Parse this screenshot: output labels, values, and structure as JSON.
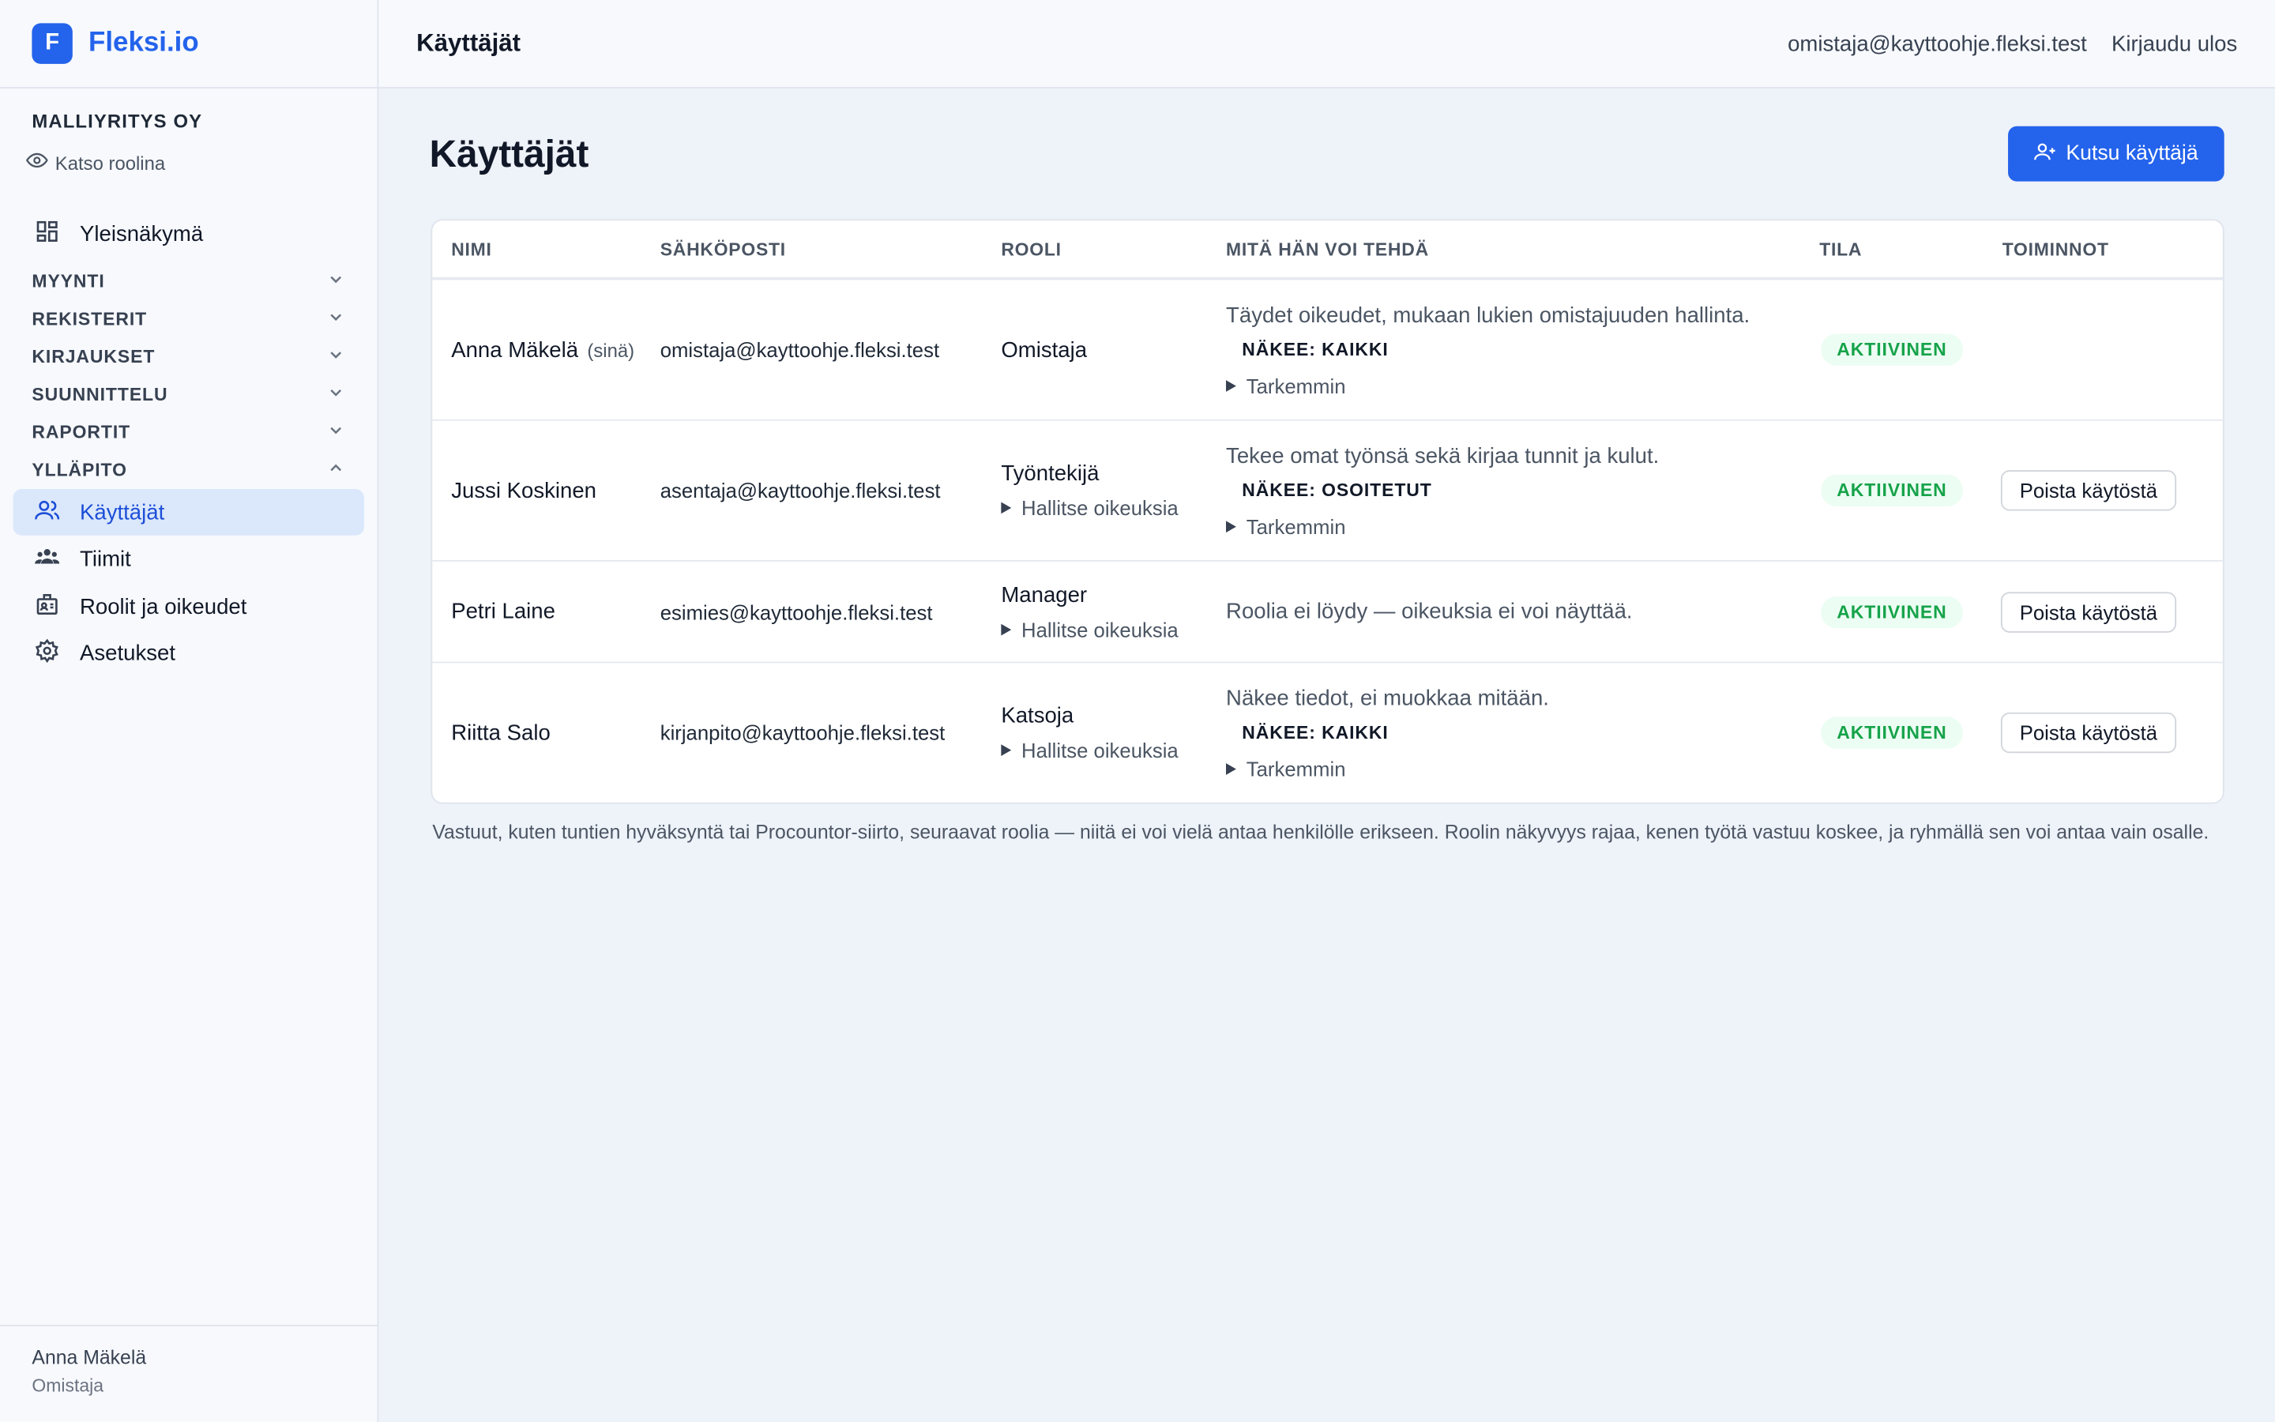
{
  "brand": {
    "logo_letter": "F",
    "name": "Fleksi.io",
    "accent": "#2463eb"
  },
  "org": {
    "name": "MALLIYRITYS OY",
    "view_as": "Katso roolina"
  },
  "sidebar": {
    "overview": "Yleisnäkymä",
    "sections": [
      {
        "label": "MYYNTI",
        "expanded": false
      },
      {
        "label": "REKISTERIT",
        "expanded": false
      },
      {
        "label": "KIRJAUKSET",
        "expanded": false
      },
      {
        "label": "SUUNNITTELU",
        "expanded": false
      },
      {
        "label": "RAPORTIT",
        "expanded": false
      },
      {
        "label": "YLLÄPITO",
        "expanded": true
      }
    ],
    "admin_items": [
      {
        "label": "Käyttäjät",
        "icon": "users-icon",
        "active": true
      },
      {
        "label": "Tiimit",
        "icon": "teams-icon",
        "active": false
      },
      {
        "label": "Roolit ja oikeudet",
        "icon": "badge-icon",
        "active": false
      },
      {
        "label": "Asetukset",
        "icon": "gear-icon",
        "active": false
      }
    ],
    "footer": {
      "name": "Anna Mäkelä",
      "role": "Omistaja"
    }
  },
  "topbar": {
    "title": "Käyttäjät",
    "email": "omistaja@kayttoohje.fleksi.test",
    "logout": "Kirjaudu ulos"
  },
  "page": {
    "title": "Käyttäjät",
    "invite_button": "Kutsu käyttäjä"
  },
  "table": {
    "headers": {
      "name": "NIMI",
      "email": "SÄHKÖPOSTI",
      "role": "ROOLI",
      "what": "MITÄ HÄN VOI TEHDÄ",
      "state": "TILA",
      "actions": "TOIMINNOT"
    },
    "rows": [
      {
        "name": "Anna Mäkelä",
        "you": "(sinä)",
        "email": "omistaja@kayttoohje.fleksi.test",
        "role": "Omistaja",
        "manage": "",
        "desc": "Täydet oikeudet, mukaan lukien omistajuuden hallinta.",
        "sees": "NÄKEE: KAIKKI",
        "more": "Tarkemmin",
        "state": "AKTIIVINEN",
        "action": ""
      },
      {
        "name": "Jussi Koskinen",
        "you": "",
        "email": "asentaja@kayttoohje.fleksi.test",
        "role": "Työntekijä",
        "manage": "Hallitse oikeuksia",
        "desc": "Tekee omat työnsä sekä kirjaa tunnit ja kulut.",
        "sees": "NÄKEE: OSOITETUT",
        "more": "Tarkemmin",
        "state": "AKTIIVINEN",
        "action": "Poista käytöstä"
      },
      {
        "name": "Petri Laine",
        "you": "",
        "email": "esimies@kayttoohje.fleksi.test",
        "role": "Manager",
        "manage": "Hallitse oikeuksia",
        "desc": "Roolia ei löydy — oikeuksia ei voi näyttää.",
        "sees": "",
        "more": "",
        "state": "AKTIIVINEN",
        "action": "Poista käytöstä"
      },
      {
        "name": "Riitta Salo",
        "you": "",
        "email": "kirjanpito@kayttoohje.fleksi.test",
        "role": "Katsoja",
        "manage": "Hallitse oikeuksia",
        "desc": "Näkee tiedot, ei muokkaa mitään.",
        "sees": "NÄKEE: KAIKKI",
        "more": "Tarkemmin",
        "state": "AKTIIVINEN",
        "action": "Poista käytöstä"
      }
    ]
  },
  "note": "Vastuut, kuten tuntien hyväksyntä tai Procountor-siirto, seuraavat roolia — niitä ei voi vielä antaa henkilölle erikseen. Roolin näkyvyys rajaa, kenen työtä vastuu koskee, ja ryhmällä sen voi antaa vain osalle."
}
